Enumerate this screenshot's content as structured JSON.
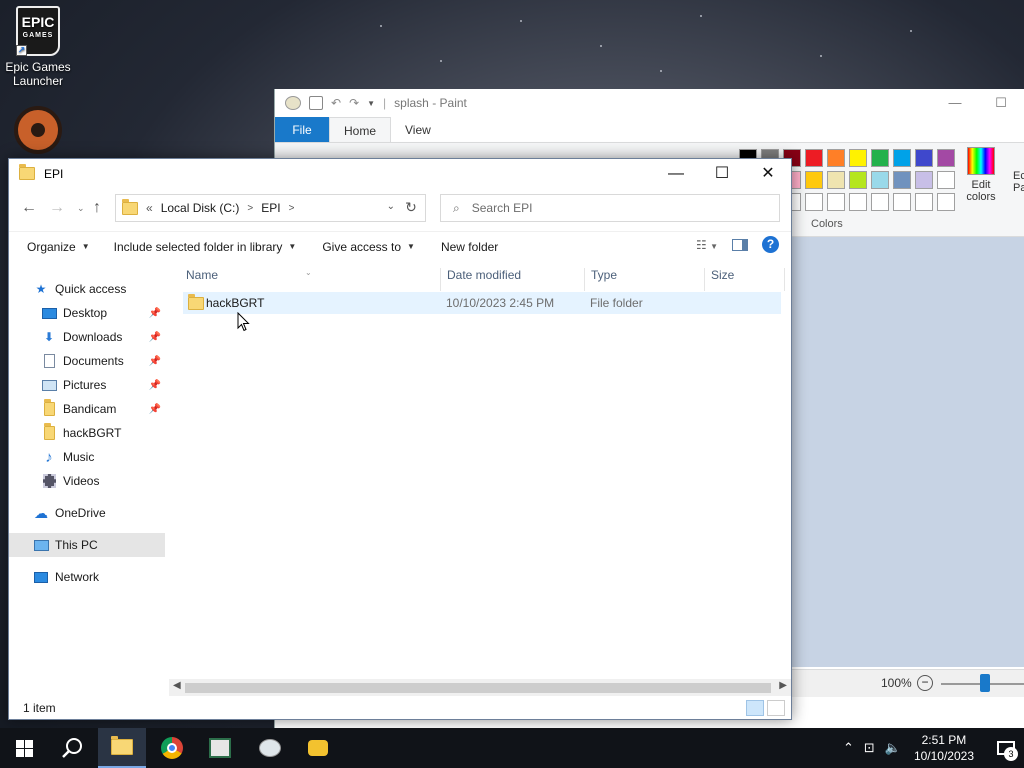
{
  "desktop": {
    "epic_logo_top": "EPIC",
    "epic_logo_bottom": "GAMES",
    "epic_label": "Epic Games Launcher"
  },
  "paint": {
    "title": "splash - Paint",
    "tabs": {
      "file": "File",
      "home": "Home",
      "view": "View"
    },
    "colors_label": "Colors",
    "edit_colors": "Edit colors",
    "edit_paint_partial": "Ec Pa",
    "zoom": "100%",
    "palette_row1": [
      "#000000",
      "#7f7f7f",
      "#880015",
      "#ed1c24",
      "#ff7f27",
      "#fff200",
      "#22b14c",
      "#00a2e8",
      "#3f48cc",
      "#a349a4"
    ],
    "palette_row2": [
      "#ffffff",
      "#b97a57",
      "#ffaec9",
      "#ffc90e",
      "#efe4b0",
      "#b5e61d",
      "#99d9ea",
      "#7092be",
      "#c8bfe7",
      "#ffffff"
    ],
    "palette_row3": [
      "#ffffff",
      "#ffffff",
      "#ffffff",
      "#ffffff",
      "#ffffff",
      "#ffffff",
      "#ffffff",
      "#ffffff",
      "#ffffff",
      "#ffffff"
    ]
  },
  "explorer": {
    "title": "EPI",
    "address": {
      "chevrons": "«",
      "segment1": "Local Disk (C:)",
      "segment2": "EPI"
    },
    "search_placeholder": "Search EPI",
    "toolbar": {
      "organize": "Organize",
      "include_library": "Include selected folder in library",
      "give_access": "Give access to",
      "new_folder": "New folder"
    },
    "nav": {
      "quick_access": "Quick access",
      "items": [
        "Desktop",
        "Downloads",
        "Documents",
        "Pictures",
        "Bandicam",
        "hackBGRT",
        "Music",
        "Videos"
      ],
      "onedrive": "OneDrive",
      "this_pc": "This PC",
      "network": "Network"
    },
    "columns": {
      "name": "Name",
      "date": "Date modified",
      "type": "Type",
      "size": "Size"
    },
    "files": [
      {
        "name": "hackBGRT",
        "date": "10/10/2023 2:45 PM",
        "type": "File folder",
        "size": ""
      }
    ],
    "status": "1 item"
  },
  "taskbar": {
    "time": "2:51 PM",
    "date": "10/10/2023",
    "notifications": "3"
  },
  "colors": {
    "accent": "#1979ca",
    "selection": "#e5f3ff",
    "taskbar": "#101318"
  }
}
